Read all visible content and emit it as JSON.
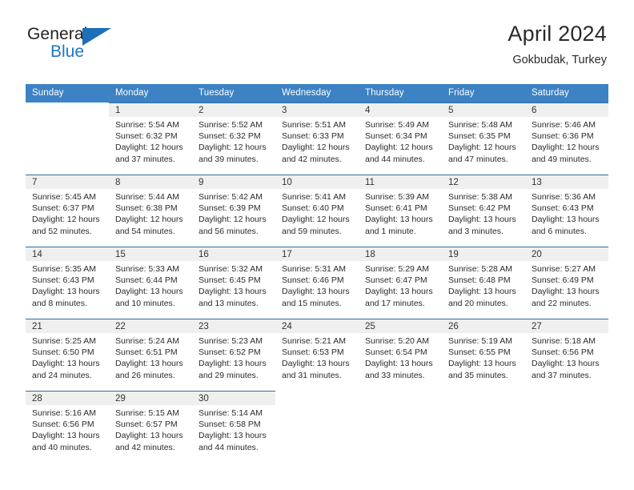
{
  "brand": {
    "name_top": "General",
    "name_bottom": "Blue"
  },
  "header": {
    "title": "April 2024",
    "location": "Gokbudak, Turkey"
  },
  "calendar": {
    "weekday_headers": [
      "Sunday",
      "Monday",
      "Tuesday",
      "Wednesday",
      "Thursday",
      "Friday",
      "Saturday"
    ],
    "colors": {
      "header_bg": "#3c82c4",
      "row_border": "#2e6da4",
      "daynum_bg": "#efefef",
      "brand_blue": "#1e77c4"
    },
    "weeks": [
      [
        {
          "day": "",
          "lines": []
        },
        {
          "day": "1",
          "lines": [
            "Sunrise: 5:54 AM",
            "Sunset: 6:32 PM",
            "Daylight: 12 hours",
            "and 37 minutes."
          ]
        },
        {
          "day": "2",
          "lines": [
            "Sunrise: 5:52 AM",
            "Sunset: 6:32 PM",
            "Daylight: 12 hours",
            "and 39 minutes."
          ]
        },
        {
          "day": "3",
          "lines": [
            "Sunrise: 5:51 AM",
            "Sunset: 6:33 PM",
            "Daylight: 12 hours",
            "and 42 minutes."
          ]
        },
        {
          "day": "4",
          "lines": [
            "Sunrise: 5:49 AM",
            "Sunset: 6:34 PM",
            "Daylight: 12 hours",
            "and 44 minutes."
          ]
        },
        {
          "day": "5",
          "lines": [
            "Sunrise: 5:48 AM",
            "Sunset: 6:35 PM",
            "Daylight: 12 hours",
            "and 47 minutes."
          ]
        },
        {
          "day": "6",
          "lines": [
            "Sunrise: 5:46 AM",
            "Sunset: 6:36 PM",
            "Daylight: 12 hours",
            "and 49 minutes."
          ]
        }
      ],
      [
        {
          "day": "7",
          "lines": [
            "Sunrise: 5:45 AM",
            "Sunset: 6:37 PM",
            "Daylight: 12 hours",
            "and 52 minutes."
          ]
        },
        {
          "day": "8",
          "lines": [
            "Sunrise: 5:44 AM",
            "Sunset: 6:38 PM",
            "Daylight: 12 hours",
            "and 54 minutes."
          ]
        },
        {
          "day": "9",
          "lines": [
            "Sunrise: 5:42 AM",
            "Sunset: 6:39 PM",
            "Daylight: 12 hours",
            "and 56 minutes."
          ]
        },
        {
          "day": "10",
          "lines": [
            "Sunrise: 5:41 AM",
            "Sunset: 6:40 PM",
            "Daylight: 12 hours",
            "and 59 minutes."
          ]
        },
        {
          "day": "11",
          "lines": [
            "Sunrise: 5:39 AM",
            "Sunset: 6:41 PM",
            "Daylight: 13 hours",
            "and 1 minute."
          ]
        },
        {
          "day": "12",
          "lines": [
            "Sunrise: 5:38 AM",
            "Sunset: 6:42 PM",
            "Daylight: 13 hours",
            "and 3 minutes."
          ]
        },
        {
          "day": "13",
          "lines": [
            "Sunrise: 5:36 AM",
            "Sunset: 6:43 PM",
            "Daylight: 13 hours",
            "and 6 minutes."
          ]
        }
      ],
      [
        {
          "day": "14",
          "lines": [
            "Sunrise: 5:35 AM",
            "Sunset: 6:43 PM",
            "Daylight: 13 hours",
            "and 8 minutes."
          ]
        },
        {
          "day": "15",
          "lines": [
            "Sunrise: 5:33 AM",
            "Sunset: 6:44 PM",
            "Daylight: 13 hours",
            "and 10 minutes."
          ]
        },
        {
          "day": "16",
          "lines": [
            "Sunrise: 5:32 AM",
            "Sunset: 6:45 PM",
            "Daylight: 13 hours",
            "and 13 minutes."
          ]
        },
        {
          "day": "17",
          "lines": [
            "Sunrise: 5:31 AM",
            "Sunset: 6:46 PM",
            "Daylight: 13 hours",
            "and 15 minutes."
          ]
        },
        {
          "day": "18",
          "lines": [
            "Sunrise: 5:29 AM",
            "Sunset: 6:47 PM",
            "Daylight: 13 hours",
            "and 17 minutes."
          ]
        },
        {
          "day": "19",
          "lines": [
            "Sunrise: 5:28 AM",
            "Sunset: 6:48 PM",
            "Daylight: 13 hours",
            "and 20 minutes."
          ]
        },
        {
          "day": "20",
          "lines": [
            "Sunrise: 5:27 AM",
            "Sunset: 6:49 PM",
            "Daylight: 13 hours",
            "and 22 minutes."
          ]
        }
      ],
      [
        {
          "day": "21",
          "lines": [
            "Sunrise: 5:25 AM",
            "Sunset: 6:50 PM",
            "Daylight: 13 hours",
            "and 24 minutes."
          ]
        },
        {
          "day": "22",
          "lines": [
            "Sunrise: 5:24 AM",
            "Sunset: 6:51 PM",
            "Daylight: 13 hours",
            "and 26 minutes."
          ]
        },
        {
          "day": "23",
          "lines": [
            "Sunrise: 5:23 AM",
            "Sunset: 6:52 PM",
            "Daylight: 13 hours",
            "and 29 minutes."
          ]
        },
        {
          "day": "24",
          "lines": [
            "Sunrise: 5:21 AM",
            "Sunset: 6:53 PM",
            "Daylight: 13 hours",
            "and 31 minutes."
          ]
        },
        {
          "day": "25",
          "lines": [
            "Sunrise: 5:20 AM",
            "Sunset: 6:54 PM",
            "Daylight: 13 hours",
            "and 33 minutes."
          ]
        },
        {
          "day": "26",
          "lines": [
            "Sunrise: 5:19 AM",
            "Sunset: 6:55 PM",
            "Daylight: 13 hours",
            "and 35 minutes."
          ]
        },
        {
          "day": "27",
          "lines": [
            "Sunrise: 5:18 AM",
            "Sunset: 6:56 PM",
            "Daylight: 13 hours",
            "and 37 minutes."
          ]
        }
      ],
      [
        {
          "day": "28",
          "lines": [
            "Sunrise: 5:16 AM",
            "Sunset: 6:56 PM",
            "Daylight: 13 hours",
            "and 40 minutes."
          ]
        },
        {
          "day": "29",
          "lines": [
            "Sunrise: 5:15 AM",
            "Sunset: 6:57 PM",
            "Daylight: 13 hours",
            "and 42 minutes."
          ]
        },
        {
          "day": "30",
          "lines": [
            "Sunrise: 5:14 AM",
            "Sunset: 6:58 PM",
            "Daylight: 13 hours",
            "and 44 minutes."
          ]
        },
        {
          "day": "",
          "lines": []
        },
        {
          "day": "",
          "lines": []
        },
        {
          "day": "",
          "lines": []
        },
        {
          "day": "",
          "lines": []
        }
      ]
    ]
  }
}
